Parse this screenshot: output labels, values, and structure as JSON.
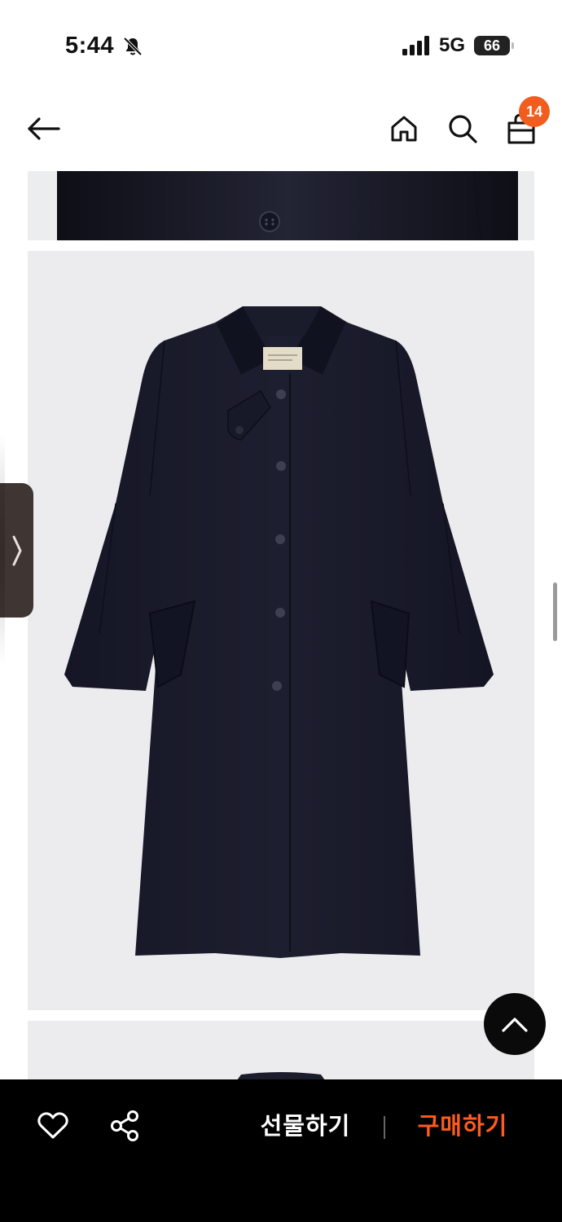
{
  "status_bar": {
    "time": "5:44",
    "network": "5G",
    "battery": "66"
  },
  "nav": {
    "cart_count": "14"
  },
  "product_images": {
    "label_text": "LOW CLASSIC"
  },
  "bottom_bar": {
    "gift_label": "선물하기",
    "buy_label": "구매하기"
  },
  "colors": {
    "accent": "#f25c1e",
    "buy_text": "#ff5a1f",
    "bar_background": "#000000",
    "coat": "#1b1c2c"
  }
}
